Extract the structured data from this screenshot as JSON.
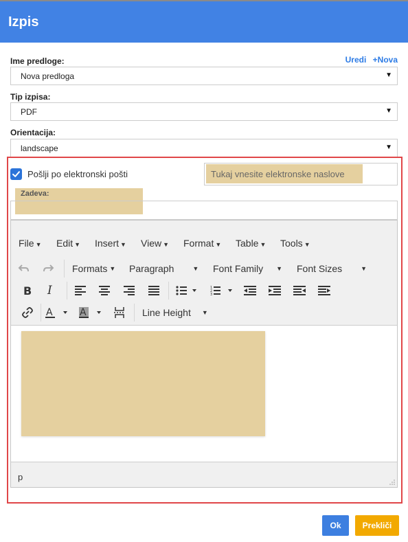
{
  "header": {
    "title": "Izpis"
  },
  "template": {
    "label": "Ime predloge:",
    "edit_link": "Uredi",
    "new_link": "+Nova",
    "value": "Nova predloga"
  },
  "print_type": {
    "label": "Tip izpisa:",
    "value": "PDF"
  },
  "orientation": {
    "label": "Orientacija:",
    "value": "landscape"
  },
  "email": {
    "checkbox_label": "Pošlji po elektronski pošti",
    "checked": true,
    "addresses_placeholder": "Tukaj vnesite elektronske naslove",
    "subject_label": "Zadeva:"
  },
  "editor": {
    "menus": [
      "File",
      "Edit",
      "Insert",
      "View",
      "Format",
      "Table",
      "Tools"
    ],
    "formats_label": "Formats",
    "paragraph_label": "Paragraph",
    "font_family_label": "Font Family",
    "font_sizes_label": "Font Sizes",
    "line_height_label": "Line Height",
    "status_path": "p"
  },
  "buttons": {
    "ok": "Ok",
    "cancel": "Prekliči"
  },
  "colors": {
    "header": "#4182e4",
    "accent": "#2c7be5",
    "highlight": "#e5d09f",
    "frame": "#e04648",
    "cancel": "#f2a900"
  }
}
